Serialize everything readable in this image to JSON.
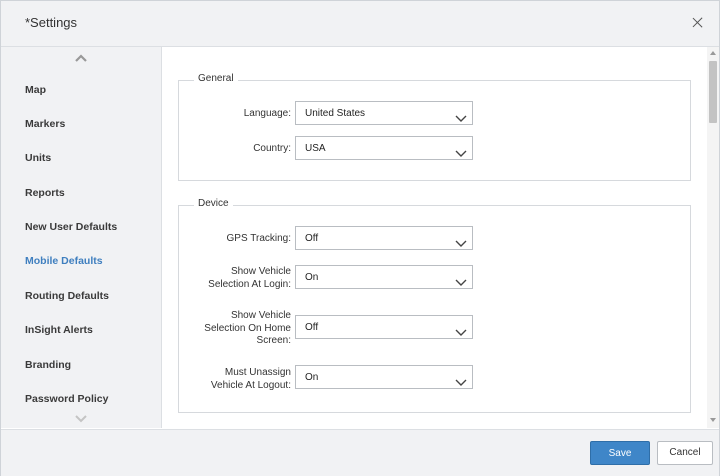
{
  "dialog": {
    "title": "*Settings"
  },
  "sidebar": {
    "items": [
      {
        "label": "Map"
      },
      {
        "label": "Markers"
      },
      {
        "label": "Units"
      },
      {
        "label": "Reports"
      },
      {
        "label": "New User Defaults"
      },
      {
        "label": "Mobile Defaults",
        "active": true
      },
      {
        "label": "Routing Defaults"
      },
      {
        "label": "InSight Alerts"
      },
      {
        "label": "Branding"
      },
      {
        "label": "Password Policy"
      }
    ]
  },
  "general": {
    "legend": "General",
    "language": {
      "label": "Language:",
      "value": "United States"
    },
    "country": {
      "label": "Country:",
      "value": "USA"
    }
  },
  "device": {
    "legend": "Device",
    "gps_tracking": {
      "label": "GPS Tracking:",
      "value": "Off"
    },
    "show_vehicle_login": {
      "label_line1": "Show Vehicle",
      "label_line2": "Selection At Login:",
      "value": "On"
    },
    "show_vehicle_home": {
      "label_line1": "Show Vehicle",
      "label_line2": "Selection On Home",
      "label_line3": "Screen:",
      "value": "Off"
    },
    "must_unassign": {
      "label_line1": "Must Unassign",
      "label_line2": "Vehicle At Logout:",
      "value": "On"
    }
  },
  "footer": {
    "save_label": "Save",
    "cancel_label": "Cancel"
  },
  "colors": {
    "accent": "#3f86c8",
    "active_nav": "#3f7fbf",
    "panel_bg": "#f1f2f4"
  },
  "icons": {
    "close": "close-icon",
    "scroll_up": "chevron-up-icon",
    "scroll_down": "chevron-down-icon",
    "dropdown": "chevron-down-icon"
  }
}
